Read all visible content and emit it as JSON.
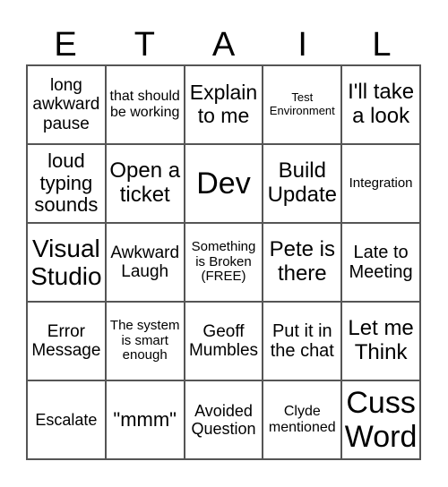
{
  "title_letters": [
    "E",
    "T",
    "A",
    "I",
    "L"
  ],
  "rows": [
    [
      "long awkward pause",
      "that should be working",
      "Explain to me",
      "Test Environment",
      "I'll take a look"
    ],
    [
      "loud typing sounds",
      "Open a ticket",
      "Dev",
      "Build Update",
      "Integration"
    ],
    [
      "Visual Studio",
      "Awkward Laugh",
      "Something is Broken (FREE)",
      "Pete is there",
      "Late to Meeting"
    ],
    [
      "Error Message",
      "The system is smart enough",
      "Geoff Mumbles",
      "Put it in the chat",
      "Let me Think"
    ],
    [
      "Escalate",
      "\"mmm\"",
      "Avoided Question",
      "Clyde mentioned",
      "Cuss Word"
    ]
  ],
  "free_space": "Something is Broken (FREE)"
}
